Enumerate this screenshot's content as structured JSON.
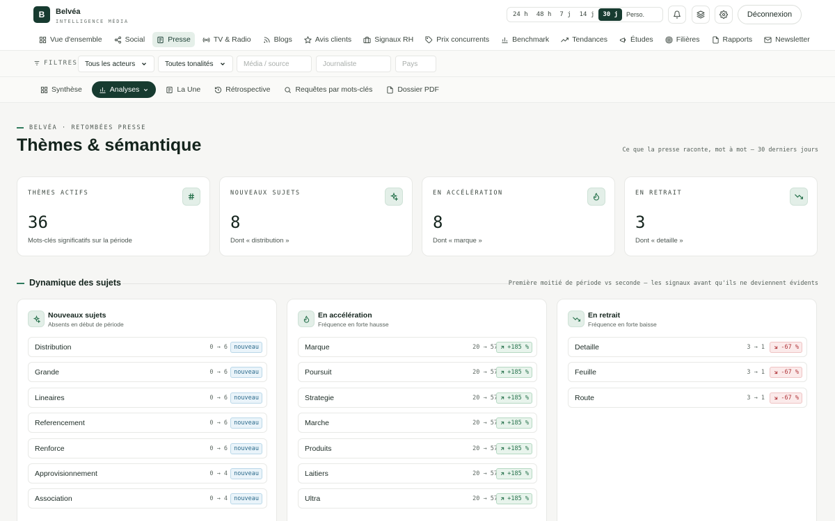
{
  "brand": {
    "logo_letter": "B",
    "name": "Belvéa",
    "tagline": "INTELLIGENCE MÉDIA"
  },
  "time_range": {
    "options": [
      "24 h",
      "48 h",
      "7 j",
      "14 j",
      "30 j",
      "Perso."
    ],
    "selected": "30 j"
  },
  "topbar": {
    "logout_label": "Déconnexion"
  },
  "nav": {
    "items": [
      {
        "label": "Vue d'ensemble",
        "icon": "grid-icon"
      },
      {
        "label": "Social",
        "icon": "share-icon"
      },
      {
        "label": "Presse",
        "icon": "newspaper-icon",
        "active": true
      },
      {
        "label": "TV & Radio",
        "icon": "broadcast-icon"
      },
      {
        "label": "Blogs",
        "icon": "rss-icon"
      },
      {
        "label": "Avis clients",
        "icon": "star-icon"
      },
      {
        "label": "Signaux RH",
        "icon": "briefcase-icon"
      },
      {
        "label": "Prix concurrents",
        "icon": "tag-icon"
      },
      {
        "label": "Benchmark",
        "icon": "bar-chart-icon"
      },
      {
        "label": "Tendances",
        "icon": "trending-up-icon"
      },
      {
        "label": "Études",
        "icon": "megaphone-icon"
      },
      {
        "label": "Filières",
        "icon": "target-icon"
      },
      {
        "label": "Rapports",
        "icon": "file-icon"
      },
      {
        "label": "Newsletter",
        "icon": "mail-icon"
      }
    ]
  },
  "filters": {
    "label": "FILTRES",
    "actors": "Tous les acteurs",
    "tone": "Toutes tonalités",
    "media_placeholder": "Média / source",
    "journalist_placeholder": "Journaliste",
    "country_placeholder": "Pays"
  },
  "subnav": {
    "items": [
      {
        "label": "Synthèse"
      },
      {
        "label": "Analyses",
        "active": true
      },
      {
        "label": "La Une"
      },
      {
        "label": "Rétrospective"
      },
      {
        "label": "Requêtes par mots-clés"
      },
      {
        "label": "Dossier PDF"
      }
    ]
  },
  "header": {
    "eyebrow": "BELVÉA · RETOMBÉES PRESSE",
    "title": "Thèmes & sémantique",
    "subtitle": "Ce que la presse raconte, mot à mot — 30 derniers jours"
  },
  "kpis": [
    {
      "label": "THÈMES ACTIFS",
      "value": "36",
      "note": "Mots-clés significatifs sur la période",
      "icon": "hash-icon"
    },
    {
      "label": "NOUVEAUX SUJETS",
      "value": "8",
      "note": "Dont « distribution »",
      "icon": "sparkles-icon"
    },
    {
      "label": "EN ACCÉLÉRATION",
      "value": "8",
      "note": "Dont « marque »",
      "icon": "flame-icon"
    },
    {
      "label": "EN RETRAIT",
      "value": "3",
      "note": "Dont « detaille »",
      "icon": "trending-down-icon"
    }
  ],
  "section": {
    "title": "Dynamique des sujets",
    "note": "Première moitié de période vs seconde — les signaux avant qu'ils ne deviennent évidents"
  },
  "panels": {
    "new": {
      "title": "Nouveaux sujets",
      "subtitle": "Absents en début de période",
      "icon": "sparkles-icon",
      "rows": [
        {
          "label": "Distribution",
          "from": "0",
          "to": "6",
          "badge": "nouveau"
        },
        {
          "label": "Grande",
          "from": "0",
          "to": "6",
          "badge": "nouveau"
        },
        {
          "label": "Lineaires",
          "from": "0",
          "to": "6",
          "badge": "nouveau"
        },
        {
          "label": "Referencement",
          "from": "0",
          "to": "6",
          "badge": "nouveau"
        },
        {
          "label": "Renforce",
          "from": "0",
          "to": "6",
          "badge": "nouveau"
        },
        {
          "label": "Approvisionnement",
          "from": "0",
          "to": "4",
          "badge": "nouveau"
        },
        {
          "label": "Association",
          "from": "0",
          "to": "4",
          "badge": "nouveau"
        }
      ]
    },
    "rising": {
      "title": "En accélération",
      "subtitle": "Fréquence en forte hausse",
      "icon": "flame-icon",
      "rows": [
        {
          "label": "Marque",
          "from": "20",
          "to": "57",
          "badge": "+185 %"
        },
        {
          "label": "Poursuit",
          "from": "20",
          "to": "57",
          "badge": "+185 %"
        },
        {
          "label": "Strategie",
          "from": "20",
          "to": "57",
          "badge": "+185 %"
        },
        {
          "label": "Marche",
          "from": "20",
          "to": "57",
          "badge": "+185 %"
        },
        {
          "label": "Produits",
          "from": "20",
          "to": "57",
          "badge": "+185 %"
        },
        {
          "label": "Laitiers",
          "from": "20",
          "to": "57",
          "badge": "+185 %"
        },
        {
          "label": "Ultra",
          "from": "20",
          "to": "57",
          "badge": "+185 %"
        }
      ]
    },
    "falling": {
      "title": "En retrait",
      "subtitle": "Fréquence en forte baisse",
      "icon": "trending-down-icon",
      "rows": [
        {
          "label": "Detaille",
          "from": "3",
          "to": "1",
          "badge": "-67 %"
        },
        {
          "label": "Feuille",
          "from": "3",
          "to": "1",
          "badge": "-67 %"
        },
        {
          "label": "Route",
          "from": "3",
          "to": "1",
          "badge": "-67 %"
        }
      ]
    }
  },
  "colors": {
    "brand": "#173b30",
    "accent": "#2f7a5c",
    "positive": "#24704a",
    "negative": "#b0353a",
    "new": "#2b6a8b"
  }
}
